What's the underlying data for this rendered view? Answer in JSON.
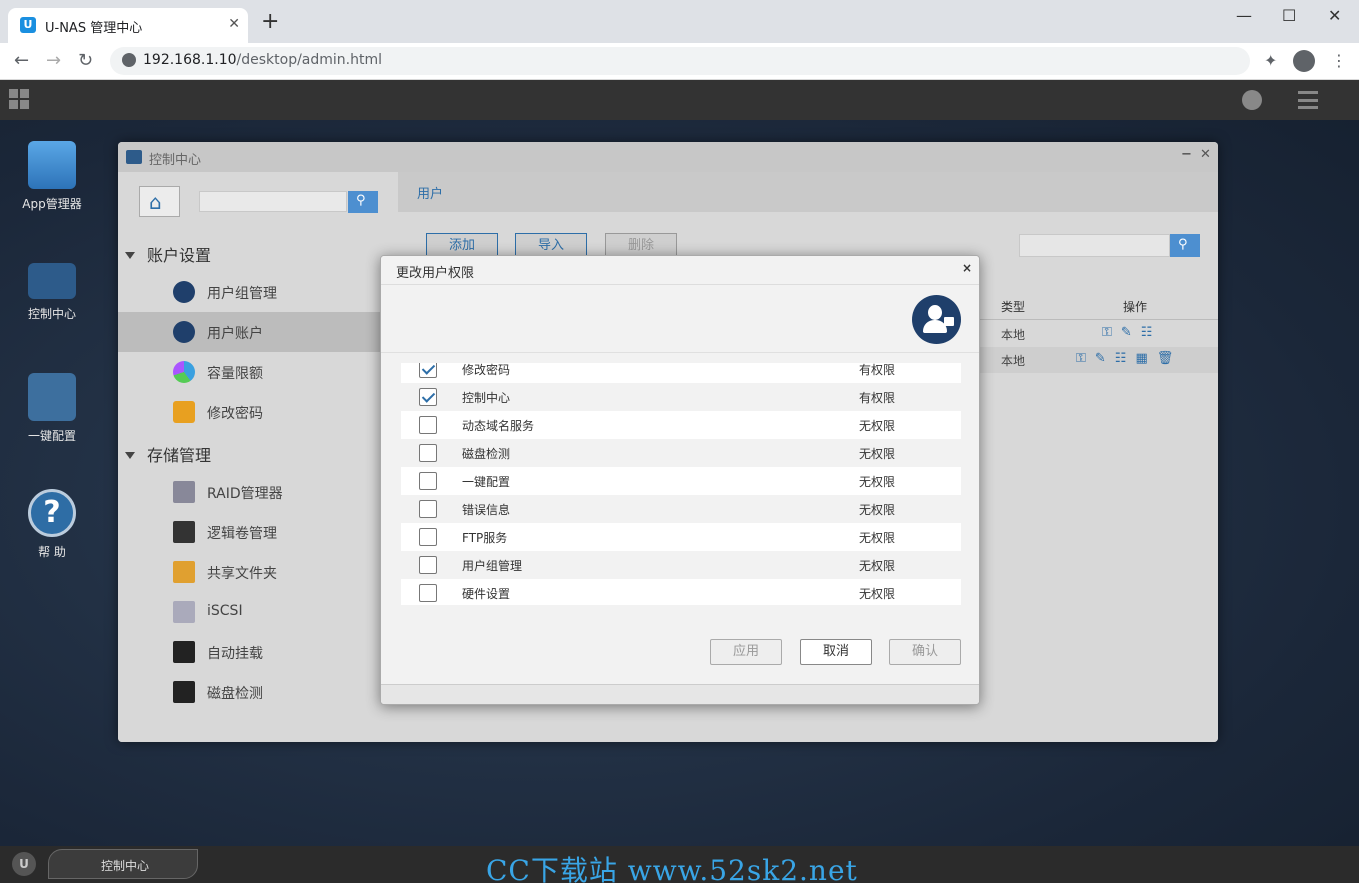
{
  "browser": {
    "tab_title": "U-NAS 管理中心",
    "url_host": "192.168.1.10",
    "url_path": "/desktop/admin.html"
  },
  "desktop": {
    "icons": [
      {
        "label": "App管理器",
        "icon": "app-store-icon"
      },
      {
        "label": "控制中心",
        "icon": "control-center-icon"
      },
      {
        "label": "一键配置",
        "icon": "mouse-icon"
      },
      {
        "label": "帮 助",
        "icon": "help-icon"
      }
    ]
  },
  "control_center": {
    "title": "控制中心",
    "sections": [
      {
        "title": "账户设置",
        "items": [
          "用户组管理",
          "用户账户",
          "容量限额",
          "修改密码"
        ]
      },
      {
        "title": "存储管理",
        "items": [
          "RAID管理器",
          "逻辑卷管理",
          "共享文件夹",
          "iSCSI",
          "自动挂载",
          "磁盘检测"
        ]
      }
    ],
    "active_item": "用户账户",
    "main_title": "用户",
    "buttons": {
      "add": "添加",
      "import": "导入",
      "delete": "删除"
    },
    "table": {
      "headers": {
        "type": "类型",
        "ops": "操作"
      },
      "rows": [
        {
          "type": "本地",
          "ops": "⚿✎☷"
        },
        {
          "type": "本地",
          "ops": "⚿✎☷▦🗑"
        }
      ]
    }
  },
  "modal": {
    "title": "更改用户权限",
    "close": "×",
    "permissions": [
      {
        "name": "修改密码",
        "value": "有权限",
        "checked": true
      },
      {
        "name": "控制中心",
        "value": "有权限",
        "checked": true
      },
      {
        "name": "动态域名服务",
        "value": "无权限",
        "checked": false
      },
      {
        "name": "磁盘检测",
        "value": "无权限",
        "checked": false
      },
      {
        "name": "一键配置",
        "value": "无权限",
        "checked": false
      },
      {
        "name": "错误信息",
        "value": "无权限",
        "checked": false
      },
      {
        "name": "FTP服务",
        "value": "无权限",
        "checked": false
      },
      {
        "name": "用户组管理",
        "value": "无权限",
        "checked": false
      },
      {
        "name": "硬件设置",
        "value": "无权限",
        "checked": false
      }
    ],
    "buttons": {
      "apply": "应用",
      "cancel": "取消",
      "confirm": "确认"
    }
  },
  "taskbar": {
    "task_label": "控制中心"
  },
  "watermark": "CC下载站 www.52sk2.net"
}
